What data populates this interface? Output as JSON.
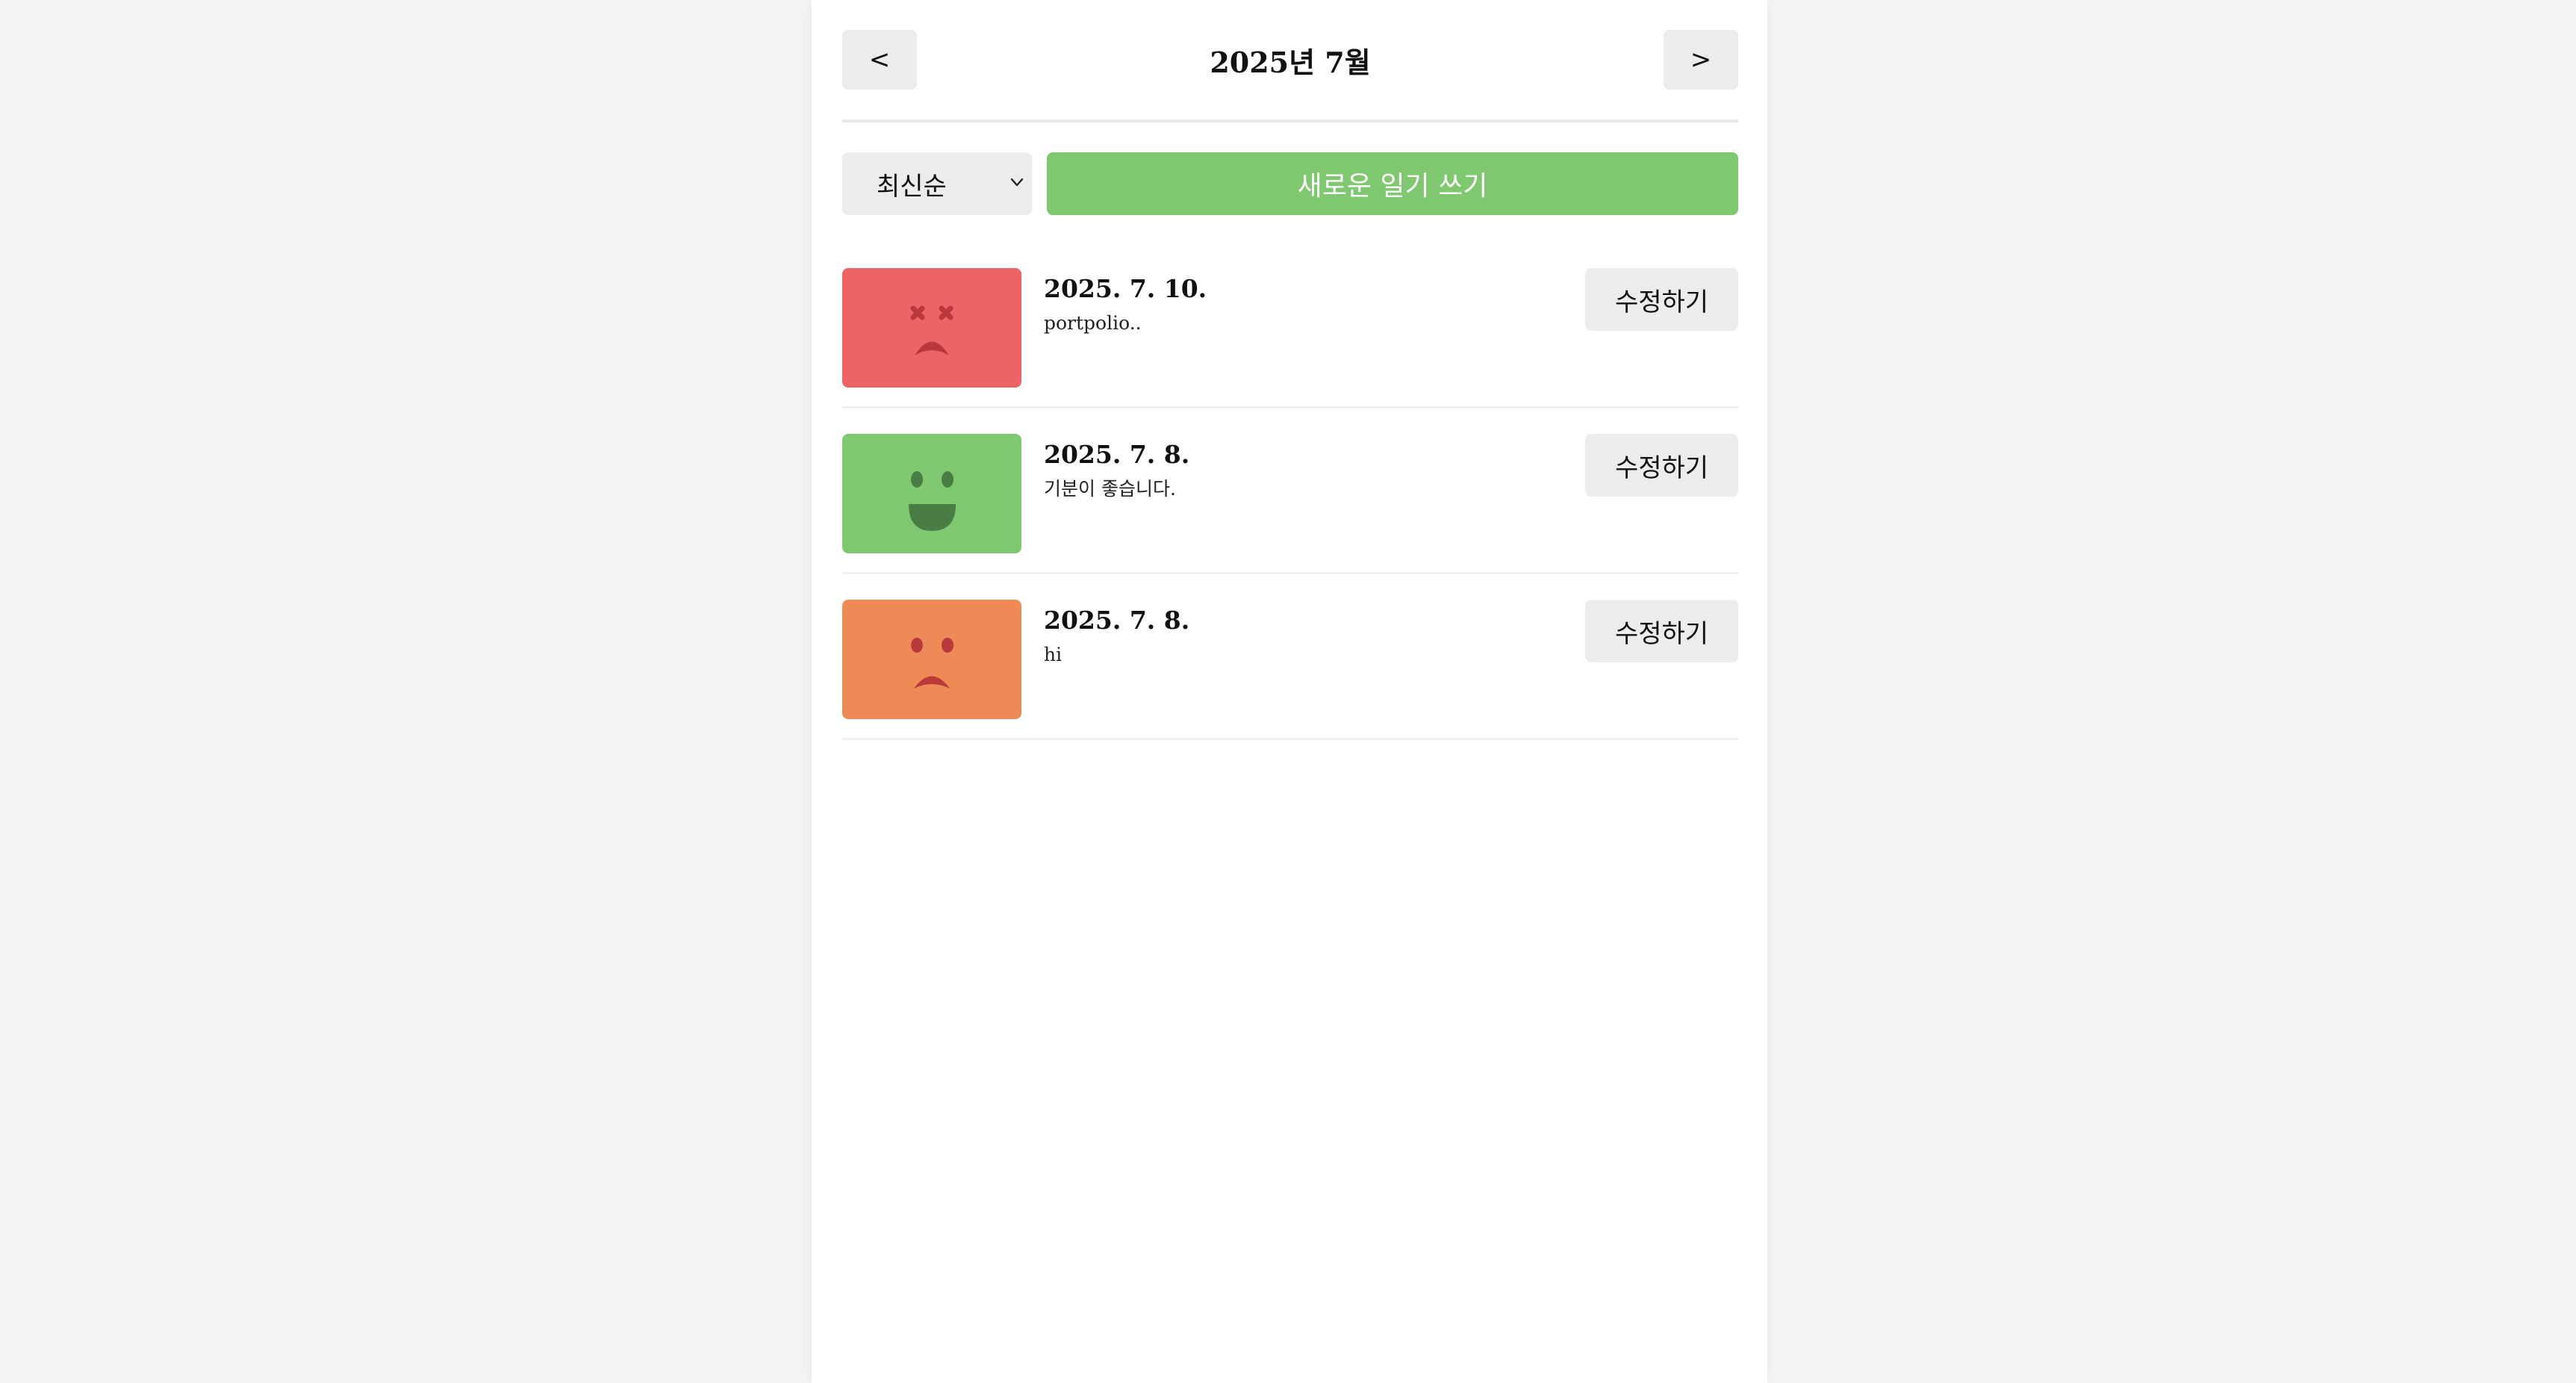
{
  "header": {
    "prev_label": "<",
    "title": "2025년 7월",
    "next_label": ">"
  },
  "menu": {
    "sort_value": "최신순",
    "new_button_label": "새로운 일기 쓰기"
  },
  "diaries": [
    {
      "date": "2025. 7. 10.",
      "content": "portpolio..",
      "emotion": "sad-x-eyes-icon",
      "color": "#ec6466",
      "edit_label": "수정하기"
    },
    {
      "date": "2025. 7. 8.",
      "content": "기분이 좋습니다.",
      "emotion": "happy-face-icon",
      "color": "#7fc86f",
      "edit_label": "수정하기"
    },
    {
      "date": "2025. 7. 8.",
      "content": "hi",
      "emotion": "sad-face-icon",
      "color": "#ee8a55",
      "edit_label": "수정하기"
    }
  ],
  "colors": {
    "accent_green": "#7fc86f",
    "button_gray": "#ececec",
    "background": "#f5f5f5"
  }
}
